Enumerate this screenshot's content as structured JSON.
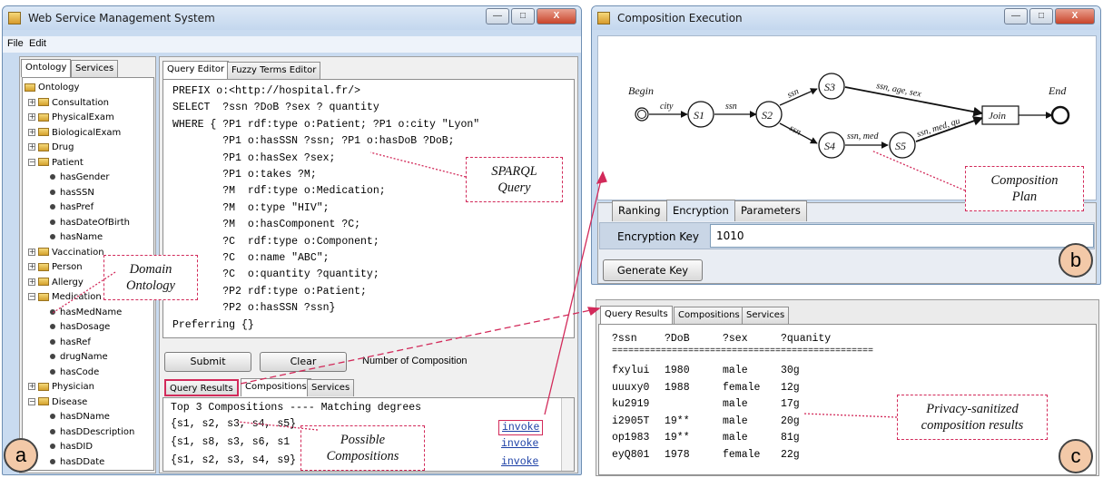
{
  "wsms": {
    "title": "Web Service Management System",
    "menu": [
      "File",
      "Edit"
    ],
    "left_tabs": [
      "Ontology",
      "Services"
    ],
    "tree": [
      {
        "label": "Ontology",
        "kind": "root"
      },
      {
        "label": "Consultation",
        "kind": "folder"
      },
      {
        "label": "PhysicalExam",
        "kind": "folder"
      },
      {
        "label": "BiologicalExam",
        "kind": "folder"
      },
      {
        "label": "Drug",
        "kind": "folder"
      },
      {
        "label": "Patient",
        "kind": "folder-open"
      },
      {
        "label": "hasGender",
        "kind": "leaf"
      },
      {
        "label": "hasSSN",
        "kind": "leaf"
      },
      {
        "label": "hasPref",
        "kind": "leaf"
      },
      {
        "label": "hasDateOfBirth",
        "kind": "leaf"
      },
      {
        "label": "hasName",
        "kind": "leaf"
      },
      {
        "label": "Vaccination",
        "kind": "folder"
      },
      {
        "label": "Person",
        "kind": "folder"
      },
      {
        "label": "Allergy",
        "kind": "folder"
      },
      {
        "label": "Medication",
        "kind": "folder-open"
      },
      {
        "label": "hasMedName",
        "kind": "leaf"
      },
      {
        "label": "hasDosage",
        "kind": "leaf"
      },
      {
        "label": "hasRef",
        "kind": "leaf"
      },
      {
        "label": "drugName",
        "kind": "leaf"
      },
      {
        "label": "hasCode",
        "kind": "leaf"
      },
      {
        "label": "Physician",
        "kind": "folder"
      },
      {
        "label": "Disease",
        "kind": "folder-open"
      },
      {
        "label": "hasDName",
        "kind": "leaf"
      },
      {
        "label": "hasDDescription",
        "kind": "leaf"
      },
      {
        "label": "hasDID",
        "kind": "leaf"
      },
      {
        "label": "hasDDate",
        "kind": "leaf"
      }
    ],
    "editor_tabs": [
      "Query Editor",
      "Fuzzy Terms Editor"
    ],
    "query_lines": [
      "PREFIX o:<http://hospital.fr/>",
      "SELECT  ?ssn ?DoB ?sex ? quantity",
      "WHERE { ?P1 rdf:type o:Patient; ?P1 o:city \"Lyon\"",
      "        ?P1 o:hasSSN ?ssn; ?P1 o:hasDoB ?DoB;",
      "        ?P1 o:hasSex ?sex;",
      "        ?P1 o:takes ?M;",
      "        ?M  rdf:type o:Medication;",
      "        ?M  o:type \"HIV\";",
      "        ?M  o:hasComponent ?C;",
      "        ?C  rdf:type o:Component;",
      "        ?C  o:name \"ABC\";",
      "        ?C  o:quantity ?quantity;",
      "        ?P2 rdf:type o:Patient;",
      "        ?P2 o:hasSSN ?ssn}",
      "Preferring {}"
    ],
    "submit_label": "Submit",
    "clear_label": "Clear",
    "num_compositions_label": "Number of Compositions (k",
    "result_tabs": [
      "Query Results",
      "Compositions",
      "Services"
    ],
    "compositions_header": "Top 3 Compositions ---- Matching degrees",
    "compositions": [
      {
        "text": "{s1, s2, s3, s4, s5}",
        "action": "invoke"
      },
      {
        "text": "{s1, s8, s3, s6, s1",
        "action": "invoke"
      },
      {
        "text": "{s1, s2, s3, s4, s9}",
        "action": "invoke"
      }
    ]
  },
  "exec": {
    "title": "Composition Execution",
    "nodes": {
      "begin": "Begin",
      "end": "End",
      "join": "Join",
      "s1": "S1",
      "s2": "S2",
      "s3": "S3",
      "s4": "S4",
      "s5": "S5"
    },
    "edges": {
      "begin_s1": "city",
      "s1_s2": "ssn",
      "s2_s3": "ssn",
      "s2_s4": "ssn",
      "s3_join": "ssn, age, sex",
      "s4_s5": "ssn, med",
      "s5_join": "ssn, med, qu"
    },
    "tabs": [
      "Ranking",
      "Encryption",
      "Parameters"
    ],
    "encryption_key_label": "Encryption Key",
    "encryption_key_value": "1010",
    "generate_key_label": "Generate Key"
  },
  "results": {
    "tabs": [
      "Query Results",
      "Compositions",
      "Services"
    ],
    "headers": [
      "?ssn",
      "?DoB",
      "?sex",
      "?quanity"
    ],
    "separator": "================================================",
    "rows": [
      [
        "fxylui",
        "1980",
        "male",
        "30g"
      ],
      [
        "uuuxy0",
        "1988",
        "female",
        "12g"
      ],
      [
        "ku2919",
        "",
        "male",
        "17g"
      ],
      [
        "i2905T",
        "19**",
        "male",
        "20g"
      ],
      [
        "op1983",
        "19**",
        "male",
        "81g"
      ],
      [
        "eyQ801",
        "1978",
        "female",
        "22g"
      ]
    ]
  },
  "callouts": {
    "sparql": [
      "SPARQL",
      "Query"
    ],
    "domain": [
      "Domain",
      "Ontology"
    ],
    "possible": [
      "Possible",
      "Compositions"
    ],
    "plan": [
      "Composition",
      "Plan"
    ],
    "privacy": [
      "Privacy-sanitized",
      "composition results"
    ]
  },
  "labels": {
    "a": "a",
    "b": "b",
    "c": "c"
  },
  "colors": {
    "callout_border": "#d22a5a",
    "label_fill": "#f3c9a8",
    "link": "#1b3fa6"
  }
}
